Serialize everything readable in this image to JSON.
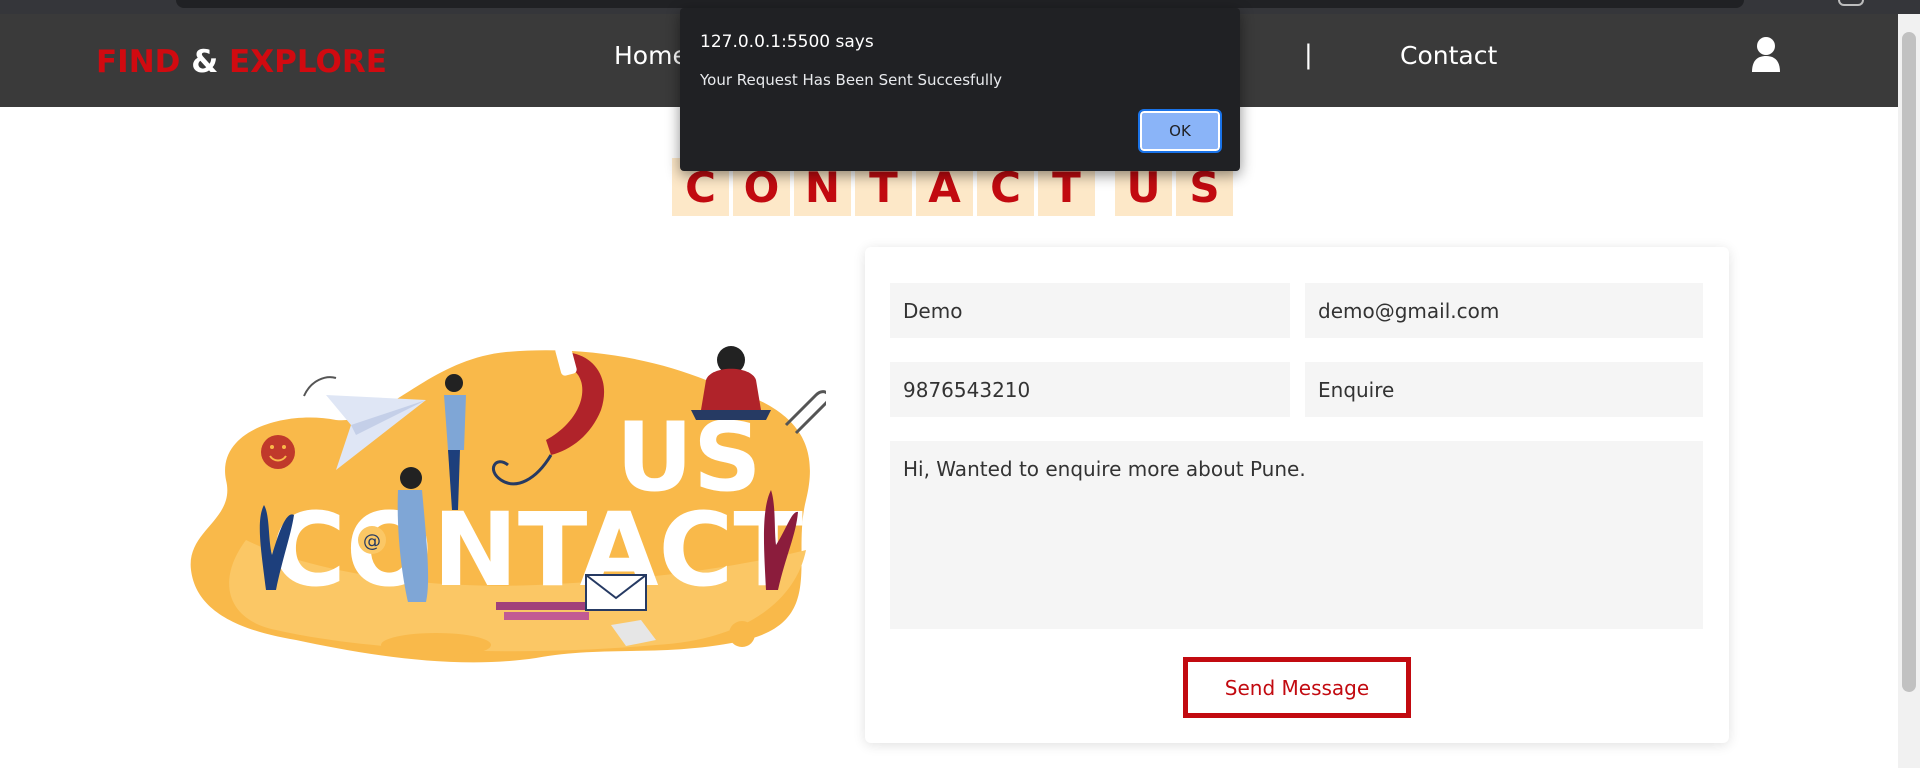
{
  "navbar": {
    "logo_part1": "FIND",
    "logo_amp": "&",
    "logo_part2": "EXPLORE",
    "links": [
      {
        "label": "Home"
      },
      {
        "label": "Contact"
      }
    ],
    "separator": "|"
  },
  "heading": {
    "letters": [
      "C",
      "O",
      "N",
      "T",
      "A",
      "C",
      "T",
      "",
      "U",
      "S"
    ]
  },
  "form": {
    "name_value": "Demo",
    "email_value": "demo@gmail.com",
    "phone_value": "9876543210",
    "subject_value": "Enquire",
    "message_value": "Hi, Wanted to enquire more about Pune.",
    "submit_label": "Send Message"
  },
  "dialog": {
    "origin": "127.0.0.1:5500 says",
    "message": "Your Request Has Been Sent Succesfully",
    "ok_label": "OK"
  },
  "illustration": {
    "word1": "US",
    "word2": "CONTACT"
  },
  "colors": {
    "brand_red": "#c20a10",
    "navbar_bg": "#3a3a3a",
    "tile_bg": "#fde8c8",
    "blob": "#f9b94a"
  }
}
